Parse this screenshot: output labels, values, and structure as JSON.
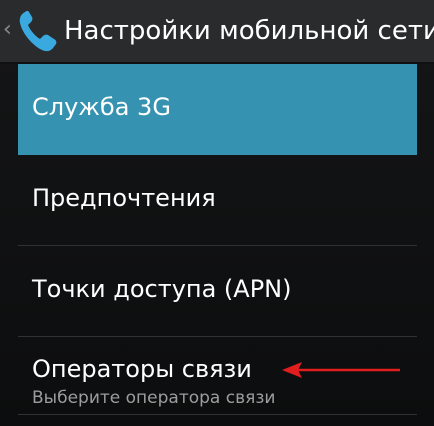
{
  "header": {
    "title": "Настройки мобильной сети",
    "back_icon": "chevron-left-icon",
    "app_icon": "phone-icon"
  },
  "list": {
    "items": [
      {
        "label": "Служба 3G",
        "selected": true
      },
      {
        "label": "Предпочтения"
      },
      {
        "label": "Точки доступа (APN)"
      },
      {
        "label": "Операторы связи",
        "summary": "Выберите оператора связи"
      }
    ]
  },
  "colors": {
    "selected_background": "#3592b1",
    "action_bar": "#2a2b2d",
    "annotation_arrow": "#e01e1e",
    "phone_icon": "#39a9df"
  }
}
